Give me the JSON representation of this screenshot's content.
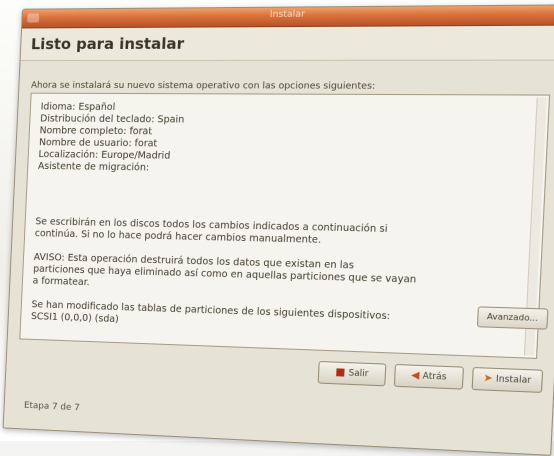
{
  "window": {
    "title": "Instalar",
    "close_glyph": "×"
  },
  "header": {
    "title": "Listo para instalar"
  },
  "intro": "Ahora se instalará su nuevo sistema operativo con las opciones siguientes:",
  "summary": {
    "settings": [
      "Idioma: Español",
      "Distribución del teclado: Spain",
      "Nombre completo: forat",
      "Nombre de usuario: forat",
      "Localización: Europe/Madrid",
      "Asistente de migración:"
    ],
    "write_notice": [
      "Se escribirán en los discos todos los cambios indicados a continuación si",
      "continúa. Si no lo hace podrá hacer cambios manualmente."
    ],
    "warning": [
      "AVISO: Esta operación destruirá todos los datos que existan en las",
      "particiones que haya eliminado así como en aquellas particiones que se vayan",
      "a formatear."
    ],
    "partitions": [
      "Se han modificado las tablas de particiones de los siguientes dispositivos:",
      "SCSI1 (0,0,0) (sda)"
    ]
  },
  "buttons": {
    "advanced": "Avanzado...",
    "exit": "Salir",
    "back": "Atrás",
    "install": "Instalar"
  },
  "icons": {
    "exit": "exit-icon",
    "back": "back-arrow-icon",
    "install": "install-icon"
  },
  "colors": {
    "titlebar": "#d8713a",
    "window_bg": "#e6e2d6",
    "box_bg": "#f6f4ee"
  },
  "status": {
    "step": "Etapa 7 de 7"
  }
}
